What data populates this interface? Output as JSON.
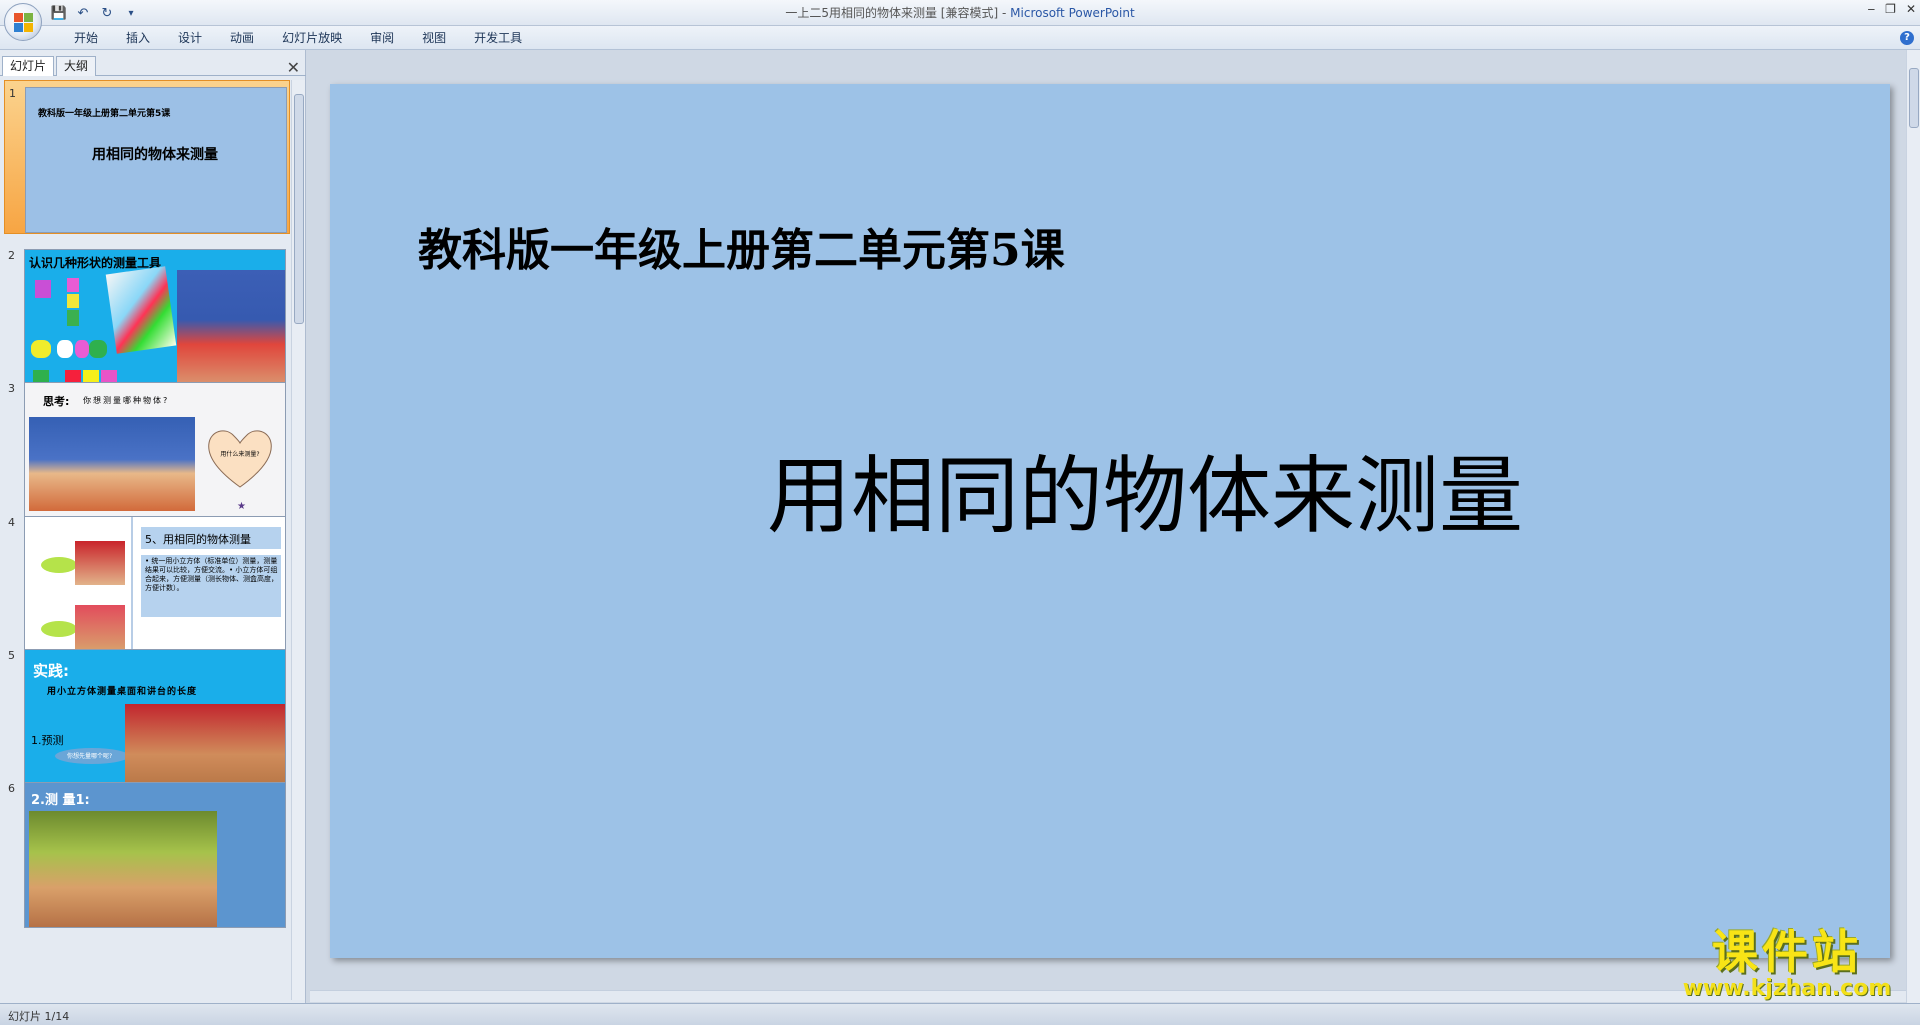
{
  "window": {
    "title": "一上二5用相同的物体来测量 [兼容模式]",
    "app_name": "Microsoft PowerPoint",
    "controls": {
      "minimize": "‒",
      "restore": "❐",
      "close": "✕"
    }
  },
  "quick_access": {
    "save": "💾",
    "undo": "↶",
    "redo": "↻",
    "more": "▾"
  },
  "ribbon_tabs": [
    "开始",
    "插入",
    "设计",
    "动画",
    "幻灯片放映",
    "审阅",
    "视图",
    "开发工具"
  ],
  "panel": {
    "tab_slides": "幻灯片",
    "tab_outline": "大纲",
    "close": "✕"
  },
  "thumbnails": [
    {
      "num": "1",
      "subtitle": "教科版一年级上册第二单元第5课",
      "title": "用相同的物体来测量"
    },
    {
      "num": "2",
      "title": "认识几种形状的测量工具"
    },
    {
      "num": "3",
      "title": "思考:",
      "subtitle": "你想测量哪种物体?",
      "heart_text": "用什么来测量?"
    },
    {
      "num": "4",
      "title": "5、用相同的物体测量",
      "bullets": "• 统一用小立方体（标准单位）测量，测量结果可以比较，方便交流。• 小立方体可组合起来，方便测量（测长物体、测盒高度，方便计数）。"
    },
    {
      "num": "5",
      "title": "实践:",
      "subtitle": "用小立方体测量桌面和讲台的长度",
      "label": "1.预测",
      "bubble": "你想先量哪个呢?"
    },
    {
      "num": "6",
      "title": "2.测  量1:"
    }
  ],
  "slide": {
    "subtitle": "教科版一年级上册第二单元第5课",
    "title": "用相同的物体来测量"
  },
  "status": {
    "slide_info": "幻灯片 1/14"
  },
  "watermark": {
    "name": "课件站",
    "url": "www.kjzhan.com"
  },
  "colors": {
    "slide_bg": "#9dc2e7",
    "accent": "#2a57a6",
    "selected_thumb": "#f7a543"
  }
}
